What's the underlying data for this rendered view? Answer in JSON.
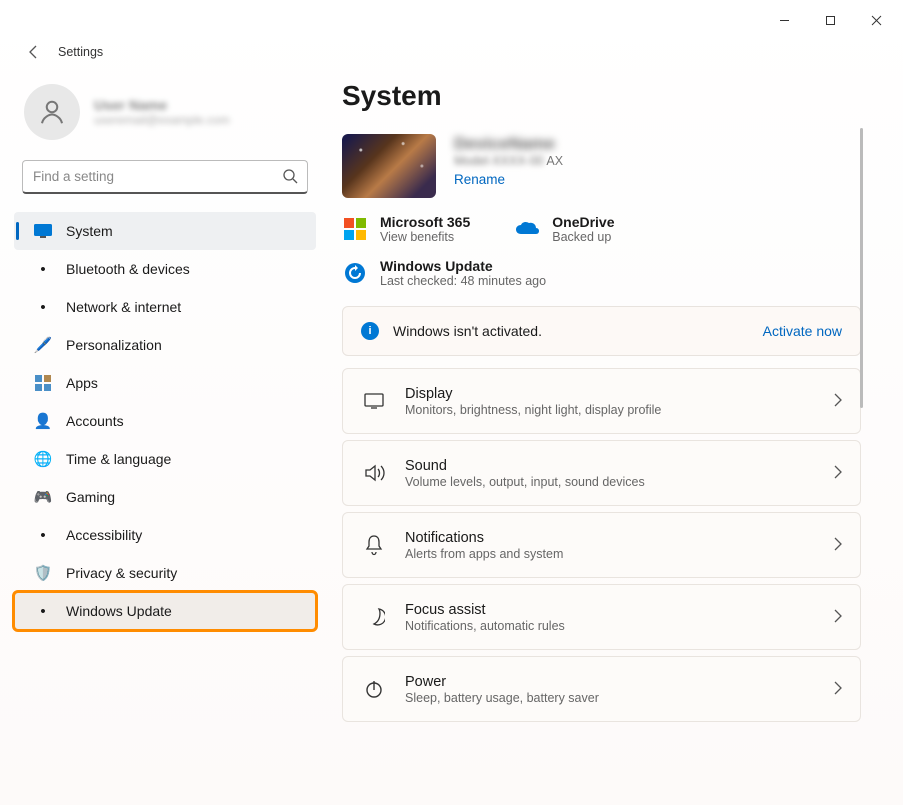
{
  "app_title": "Settings",
  "window_controls": {
    "min": "−",
    "max": "▢",
    "close": "✕"
  },
  "profile": {
    "name": "User Name",
    "email": "useremail@example.com"
  },
  "search": {
    "placeholder": "Find a setting"
  },
  "nav": [
    {
      "id": "system",
      "label": "System",
      "icon": "🖥️",
      "selected": true
    },
    {
      "id": "bluetooth",
      "label": "Bluetooth & devices",
      "icon": "bt"
    },
    {
      "id": "network",
      "label": "Network & internet",
      "icon": "wifi"
    },
    {
      "id": "personalization",
      "label": "Personalization",
      "icon": "✏️"
    },
    {
      "id": "apps",
      "label": "Apps",
      "icon": "apps"
    },
    {
      "id": "accounts",
      "label": "Accounts",
      "icon": "👤"
    },
    {
      "id": "time",
      "label": "Time & language",
      "icon": "🌐"
    },
    {
      "id": "gaming",
      "label": "Gaming",
      "icon": "🎮"
    },
    {
      "id": "accessibility",
      "label": "Accessibility",
      "icon": "acc"
    },
    {
      "id": "privacy",
      "label": "Privacy & security",
      "icon": "🛡️"
    },
    {
      "id": "update",
      "label": "Windows Update",
      "icon": "upd",
      "highlighted": true
    }
  ],
  "page": {
    "title": "System",
    "device": {
      "name": "DeviceName",
      "model_suffix": " AX",
      "rename": "Rename"
    },
    "services": [
      {
        "id": "m365",
        "title": "Microsoft 365",
        "sub": "View benefits"
      },
      {
        "id": "onedrive",
        "title": "OneDrive",
        "sub": "Backed up"
      },
      {
        "id": "winupdate",
        "title": "Windows Update",
        "sub": "Last checked: 48 minutes ago"
      }
    ],
    "banner": {
      "text": "Windows isn't activated.",
      "action": "Activate now"
    },
    "cards": [
      {
        "id": "display",
        "title": "Display",
        "sub": "Monitors, brightness, night light, display profile"
      },
      {
        "id": "sound",
        "title": "Sound",
        "sub": "Volume levels, output, input, sound devices"
      },
      {
        "id": "notifications",
        "title": "Notifications",
        "sub": "Alerts from apps and system"
      },
      {
        "id": "focus",
        "title": "Focus assist",
        "sub": "Notifications, automatic rules"
      },
      {
        "id": "power",
        "title": "Power",
        "sub": "Sleep, battery usage, battery saver"
      }
    ]
  },
  "colors": {
    "accent": "#0067c0",
    "highlight": "#ff8c00"
  }
}
